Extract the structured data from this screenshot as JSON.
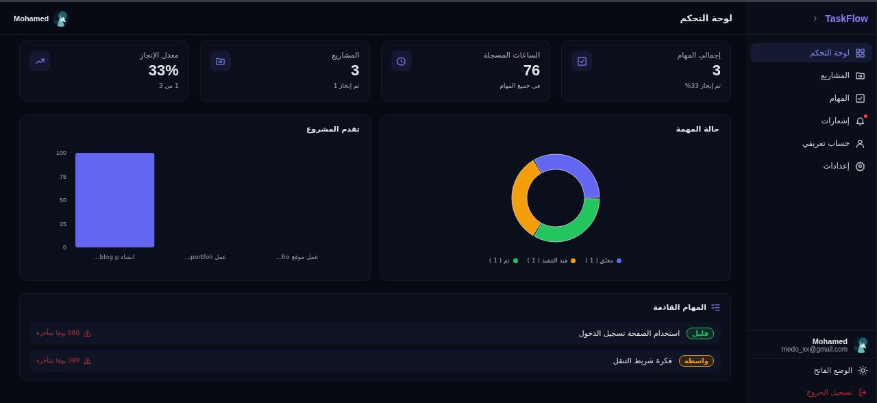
{
  "sidebar": {
    "brand": "TaskFlow",
    "items": [
      {
        "label": "لوحة التحكم",
        "selected": true,
        "badge": false
      },
      {
        "label": "المشاريع",
        "selected": false,
        "badge": false
      },
      {
        "label": "المهام",
        "selected": false,
        "badge": false
      },
      {
        "label": "إشعارات",
        "selected": false,
        "badge": true
      },
      {
        "label": "حساب تعريفي",
        "selected": false,
        "badge": false
      },
      {
        "label": "إعدادات",
        "selected": false,
        "badge": false
      }
    ],
    "user": {
      "name": "Mohamed",
      "email": "medo_xx@gmail.com"
    },
    "theme_toggle": "الوضع الفاتح",
    "logout": "تسجيل الخروج"
  },
  "header": {
    "title": "لوحة التحكم",
    "user_name": "Mohamed"
  },
  "stats": [
    {
      "label": "إجمالي المهام",
      "value": "3",
      "note": "تم إنجاز 33%"
    },
    {
      "label": "الساعات المسجلة",
      "value": "76",
      "note": "في جميع المهام"
    },
    {
      "label": "المشاريع",
      "value": "3",
      "note": "تم إنجاز 1"
    },
    {
      "label": "معدل الإنجاز",
      "value": "33%",
      "note": "1 من 3"
    }
  ],
  "status_panel": {
    "title": "حالة المهمة",
    "chart_data": {
      "type": "donut",
      "categories": [
        "معلق",
        "قيد التنفيذ",
        "تم"
      ],
      "values": [
        33.3,
        33.3,
        33.4
      ]
    },
    "legend": [
      {
        "count": "( 1 )",
        "color": "#6366f1"
      },
      {
        "count": "( 1 )",
        "color": "#f59e0b"
      },
      {
        "count": "( 1 )",
        "color": "#22c55e"
      }
    ]
  },
  "progress_panel": {
    "title": "تقدم المشروع",
    "chart_data": {
      "type": "bar",
      "categories": [
        "انشاء blog p...",
        "عمل portfoli...",
        "عمل موقع fro..."
      ],
      "series": [
        {
          "color": "#6366f1",
          "values": [
            100,
            0,
            0
          ]
        }
      ],
      "ylim": [
        0,
        100
      ],
      "yticks": [
        0,
        25,
        50,
        75,
        100
      ]
    }
  },
  "upcoming": {
    "title": "المهام القادمة",
    "tasks": [
      {
        "priority": "قليل",
        "color": "#22c55e",
        "title": "استخدام الصفحة تسجيل الدخول",
        "overdue": "680 يومًا متأخرة"
      },
      {
        "priority": "واسطة",
        "color": "#f59e0b",
        "title": "فكرة شريط التنقل",
        "overdue": "389 يومًا متأخرة"
      }
    ]
  }
}
